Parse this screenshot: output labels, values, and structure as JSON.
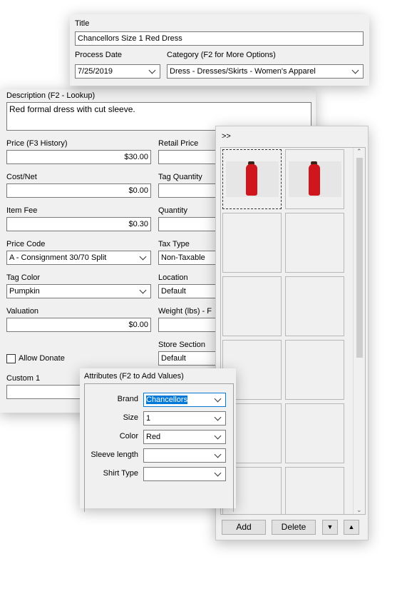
{
  "header": {
    "title_label": "Title",
    "title_value": "Chancellors Size 1 Red Dress",
    "process_date_label": "Process Date",
    "process_date_value": "7/25/2019",
    "category_label": "Category (F2 for More Options)",
    "category_value": "Dress - Dresses/Skirts - Women's Apparel"
  },
  "form": {
    "description_label": "Description (F2 - Lookup)",
    "description_value": "Red formal dress with cut sleeve.",
    "price_label": "Price (F3 History)",
    "price_value": "$30.00",
    "retail_price_label": "Retail Price",
    "cost_label": "Cost/Net",
    "cost_value": "$0.00",
    "tag_quantity_label": "Tag Quantity",
    "item_fee_label": "Item Fee",
    "item_fee_value": "$0.30",
    "quantity_label": "Quantity",
    "price_code_label": "Price Code",
    "price_code_value": "A - Consignment 30/70 Split",
    "tax_type_label": "Tax Type",
    "tax_type_value": "Non-Taxable",
    "tag_color_label": "Tag Color",
    "tag_color_value": "Pumpkin",
    "location_label": "Location",
    "location_value": "Default",
    "valuation_label": "Valuation",
    "valuation_value": "$0.00",
    "weight_label": "Weight (lbs) - F",
    "allow_donate_label": "Allow Donate",
    "allow_donate_checked": false,
    "store_section_label": "Store Section",
    "store_section_value": "Default",
    "custom1_label": "Custom 1"
  },
  "photos": {
    "expand_label": ">>",
    "add_label": "Add",
    "delete_label": "Delete",
    "photo_count": 2
  },
  "attributes": {
    "title": "Attributes (F2 to Add Values)",
    "rows": [
      {
        "label": "Brand",
        "value": "Chancellors"
      },
      {
        "label": "Size",
        "value": "1"
      },
      {
        "label": "Color",
        "value": "Red"
      },
      {
        "label": "Sleeve length",
        "value": ""
      },
      {
        "label": "Shirt Type",
        "value": ""
      }
    ]
  }
}
